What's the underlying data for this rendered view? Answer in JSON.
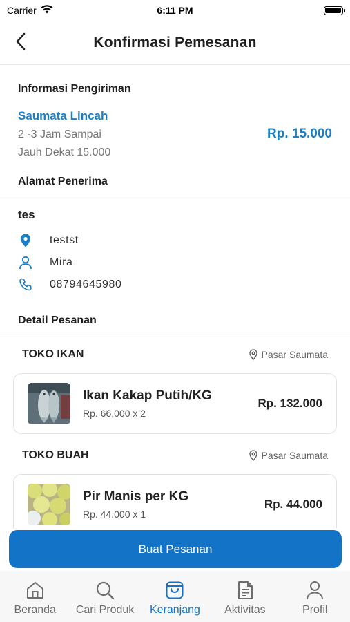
{
  "status_bar": {
    "carrier": "Carrier",
    "time": "6:11 PM"
  },
  "header": {
    "title": "Konfirmasi Pemesanan"
  },
  "shipping": {
    "section_title": "Informasi Pengiriman",
    "courier_name": "Saumata Lincah",
    "eta": "2 -3 Jam Sampai",
    "distance_fee": "Jauh Dekat 15.000",
    "price": "Rp. 15.000"
  },
  "address": {
    "section_title": "Alamat Penerima",
    "label": "tes",
    "location": "testst",
    "recipient": "Mira",
    "phone": "08794645980"
  },
  "order": {
    "section_title": "Detail Pesanan",
    "stores": [
      {
        "name": "TOKO IKAN",
        "location": "Pasar Saumata",
        "item": {
          "name": "Ikan Kakap Putih/KG",
          "qty": "Rp. 66.000 x 2",
          "price": "Rp. 132.000"
        }
      },
      {
        "name": "TOKO BUAH",
        "location": "Pasar Saumata",
        "item": {
          "name": "Pir Manis per KG",
          "qty": "Rp. 44.000 x 1",
          "price": "Rp. 44.000"
        }
      }
    ]
  },
  "cta": {
    "label": "Buat Pesanan"
  },
  "tabbar": {
    "tabs": [
      {
        "label": "Beranda",
        "icon": "home-icon"
      },
      {
        "label": "Cari Produk",
        "icon": "search-icon"
      },
      {
        "label": "Keranjang",
        "icon": "cart-bag-icon",
        "active": true
      },
      {
        "label": "Aktivitas",
        "icon": "document-icon"
      },
      {
        "label": "Profil",
        "icon": "user-icon"
      }
    ]
  },
  "colors": {
    "accent": "#1373c6",
    "link": "#1a7fc4",
    "inactive": "#6e6e6e"
  }
}
